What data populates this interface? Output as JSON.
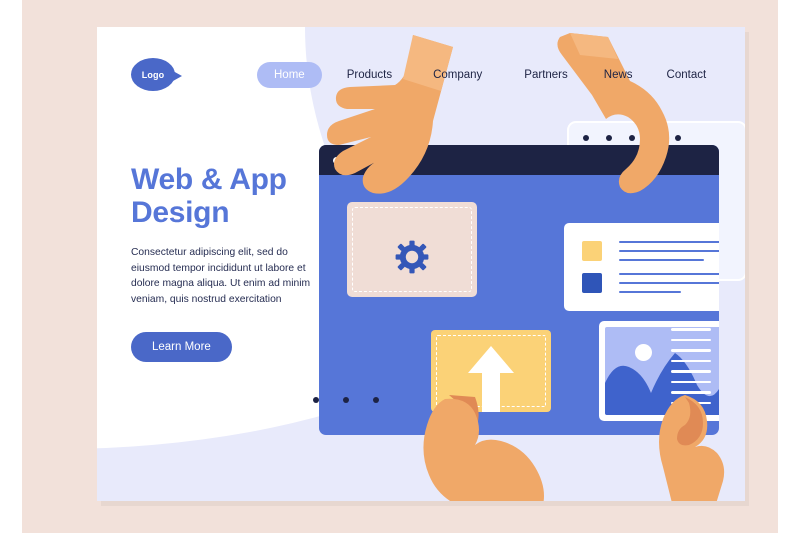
{
  "page": {
    "frame_color": "#f2e1da",
    "card_background": "#ffffff",
    "accent_blue": "#5676d8",
    "accent_dark": "#1d2344",
    "accent_yellow": "#fbd277",
    "accent_peach": "#f0ddd6",
    "accent_lavender": "#e8eafb",
    "skin_tone": "#f0a868"
  },
  "nav": {
    "logo_label": "Logo",
    "links": [
      {
        "label": "Home",
        "active": true
      },
      {
        "label": "Products",
        "active": false
      },
      {
        "label": "Company",
        "active": false
      },
      {
        "label": "Partners",
        "active": false
      },
      {
        "label": "News",
        "active": false
      },
      {
        "label": "Contact",
        "active": false
      }
    ]
  },
  "hero": {
    "headline_line1": "Web & App",
    "headline_line2": "Design",
    "body": "Consectetur adipiscing elit, sed do eiusmod tempor incididunt ut labore et dolore magna aliqua. Ut enim ad minim veniam, quis nostrud exercitation",
    "cta_label": "Learn More"
  },
  "illustration": {
    "back_window": {
      "dot_count": 5
    },
    "main_window": {
      "dot_count": 3
    },
    "panels": {
      "gear_panel": {
        "icon": "gear-icon",
        "fill": "#f0ddd6"
      },
      "text_card": {
        "squares": [
          "#fbd277",
          "#2f55b8"
        ],
        "line_rows": 6
      },
      "upload_panel": {
        "icon": "upload-arrow-icon",
        "fill": "#fbd277"
      },
      "image_panel": {
        "icon": "landscape-image-icon",
        "fill": "#aebcf5"
      }
    },
    "line_stacks": [
      {
        "name": "left-line-stack",
        "count": 8
      },
      {
        "name": "right-line-stack",
        "count": 8
      }
    ],
    "hands": [
      {
        "name": "hand-top-left",
        "action": "holding-gear"
      },
      {
        "name": "hand-top-right",
        "action": "pointing-at-card"
      },
      {
        "name": "hand-bottom-left",
        "action": "holding-upload-panel"
      },
      {
        "name": "hand-bottom-right",
        "action": "holding-image-panel"
      }
    ],
    "decorative_dots": {
      "name": "decorative-dots",
      "count": 3
    }
  }
}
